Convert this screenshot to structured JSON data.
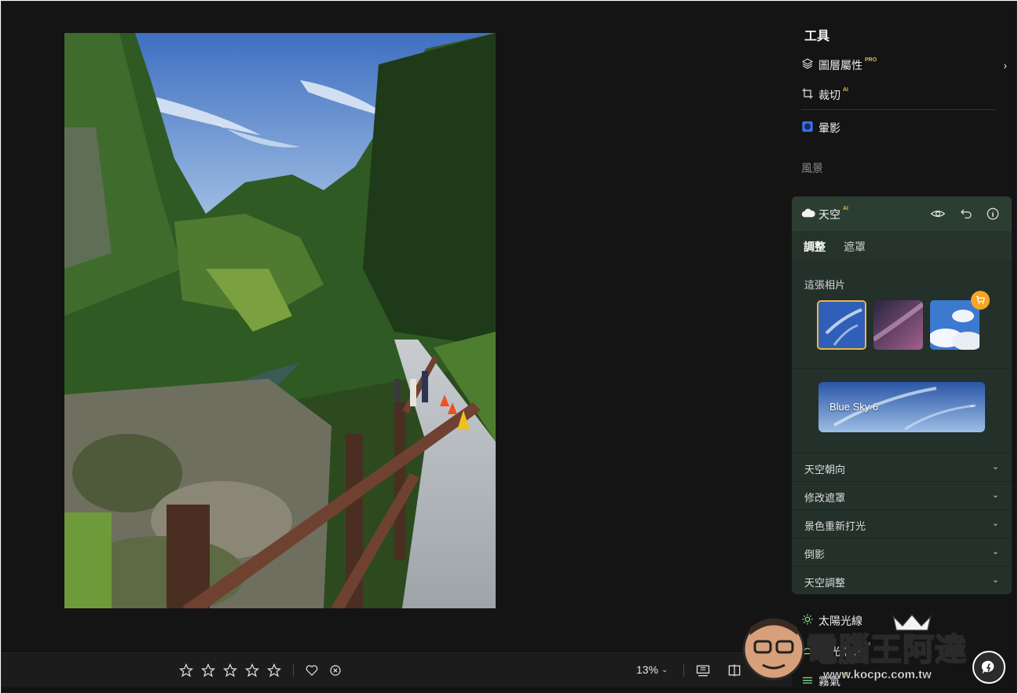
{
  "toolbar": {
    "zoom": "13%",
    "rating": 0,
    "max_rating": 5
  },
  "panel": {
    "section_title": "工具",
    "tools": [
      {
        "label": "圖層屬性",
        "badge": "PRO",
        "badge_color": "#e7b64a"
      },
      {
        "label": "裁切",
        "badge": "AI",
        "badge_color": "#e7b64a"
      },
      {
        "label": "暈影",
        "badge": "",
        "badge_color": ""
      }
    ],
    "category": "風景",
    "sky": {
      "title": "天空",
      "badge": "AI",
      "tabs": [
        "調整",
        "遮罩"
      ],
      "active_tab": "調整",
      "this_photo_label": "這張相片",
      "selected_sky": "Blue Sky 6",
      "accordions": [
        "天空朝向",
        "修改遮罩",
        "景色重新打光",
        "倒影",
        "天空調整"
      ]
    },
    "lower_tools": [
      {
        "label": "太陽光線",
        "badge": ""
      },
      {
        "label": "暮光增強",
        "badge": "AI"
      },
      {
        "label": "霧氣",
        "badge": "AI"
      }
    ]
  },
  "watermark": {
    "text": "電腦王阿達",
    "url": "www.kocpc.com.tw"
  },
  "colors": {
    "background": "#141414",
    "panel_card": "#24302a",
    "accent_gold": "#e7b64a",
    "selection_border": "#f0b443",
    "vignette_icon": "#3d6ef0"
  }
}
